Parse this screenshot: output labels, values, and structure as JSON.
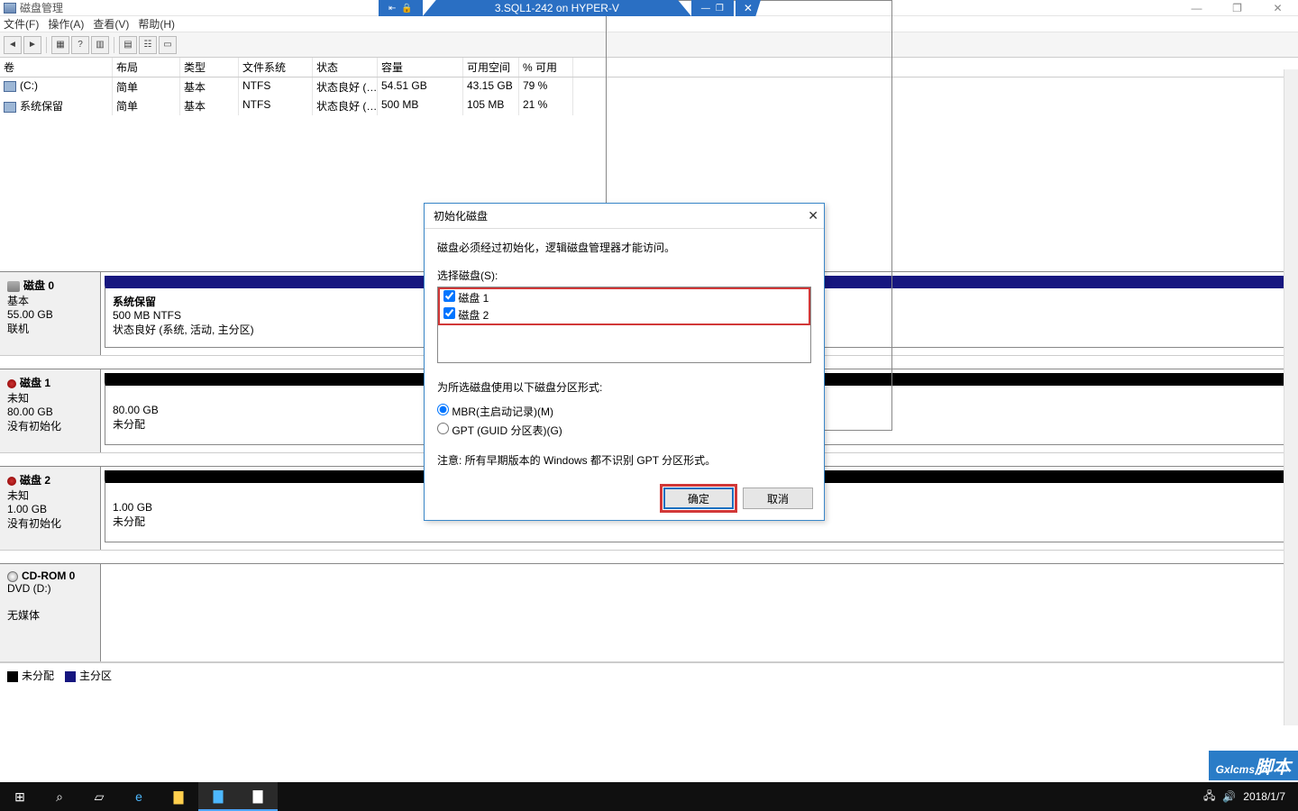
{
  "window": {
    "app_title": "磁盘管理",
    "hv_title": "3.SQL1-242 on HYPER-V",
    "win_min": "—",
    "win_max": "❐",
    "win_close": "✕"
  },
  "hv_icons": {
    "pin": "⇤",
    "lock": "🔒",
    "min": "—",
    "max": "❐",
    "x": "✕"
  },
  "menu": {
    "file": "文件(F)",
    "action": "操作(A)",
    "view": "查看(V)",
    "help": "帮助(H)"
  },
  "columns": {
    "vol": "卷",
    "layout": "布局",
    "type": "类型",
    "fs": "文件系统",
    "status": "状态",
    "cap": "容量",
    "free": "可用空间",
    "pct": "% 可用"
  },
  "volumes": [
    {
      "vol": "(C:)",
      "layout": "简单",
      "type": "基本",
      "fs": "NTFS",
      "status": "状态良好 (…",
      "cap": "54.51 GB",
      "free": "43.15 GB",
      "pct": "79 %"
    },
    {
      "vol": "系统保留",
      "layout": "简单",
      "type": "基本",
      "fs": "NTFS",
      "status": "状态良好 (…",
      "cap": "500 MB",
      "free": "105 MB",
      "pct": "21 %"
    }
  ],
  "disks": {
    "d0": {
      "name": "磁盘 0",
      "type": "基本",
      "size": "55.00 GB",
      "state": "联机",
      "p1_title": "系统保留",
      "p1_sub": "500 MB NTFS",
      "p1_stat": "状态良好 (系统, 活动, 主分区)"
    },
    "d1": {
      "name": "磁盘 1",
      "type": "未知",
      "size": "80.00 GB",
      "state": "没有初始化",
      "p1_sub": "80.00 GB",
      "p1_stat": "未分配"
    },
    "d2": {
      "name": "磁盘 2",
      "type": "未知",
      "size": "1.00 GB",
      "state": "没有初始化",
      "p1_sub": "1.00 GB",
      "p1_stat": "未分配"
    },
    "cd": {
      "name": "CD-ROM 0",
      "type": "DVD (D:)",
      "state": "无媒体"
    }
  },
  "legend": {
    "unalloc": "未分配",
    "primary": "主分区"
  },
  "dialog": {
    "title": "初始化磁盘",
    "msg": "磁盘必须经过初始化，逻辑磁盘管理器才能访问。",
    "select_label": "选择磁盘(S):",
    "disk1": "磁盘 1",
    "disk2": "磁盘 2",
    "style_label": "为所选磁盘使用以下磁盘分区形式:",
    "mbr": "MBR(主启动记录)(M)",
    "gpt": "GPT (GUID 分区表)(G)",
    "note": "注意: 所有早期版本的 Windows 都不识别 GPT 分区形式。",
    "ok": "确定",
    "cancel": "取消"
  },
  "tray": {
    "date": "2018/1/7"
  },
  "watermark": {
    "brand": "Gxlcms",
    "sub": "脚本"
  }
}
